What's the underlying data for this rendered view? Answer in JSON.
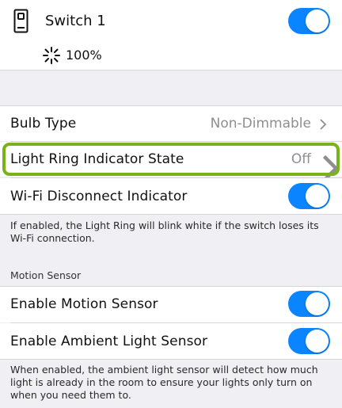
{
  "device": {
    "name": "Switch 1",
    "brightness": "100%",
    "switch_on": true
  },
  "settings": {
    "bulb_type": {
      "label": "Bulb Type",
      "value": "Non-Dimmable"
    },
    "light_ring": {
      "label": "Light Ring Indicator State",
      "value": "Off"
    },
    "wifi_indicator": {
      "label": "Wi-Fi Disconnect Indicator",
      "enabled": true
    },
    "wifi_note": "If enabled, the Light Ring will blink white if the switch loses its Wi-Fi connection."
  },
  "motion": {
    "section_title": "Motion Sensor",
    "motion_sensor": {
      "label": "Enable Motion Sensor",
      "enabled": true
    },
    "ambient_sensor": {
      "label": "Enable Ambient Light Sensor",
      "enabled": true
    },
    "ambient_note": "When enabled, the ambient light sensor will detect how much light is already in the room to ensure your lights only turn on when you need them to."
  },
  "colors": {
    "toggle_on": "#0a84ff",
    "highlight": "#7ab317",
    "background": "#efeff4"
  }
}
